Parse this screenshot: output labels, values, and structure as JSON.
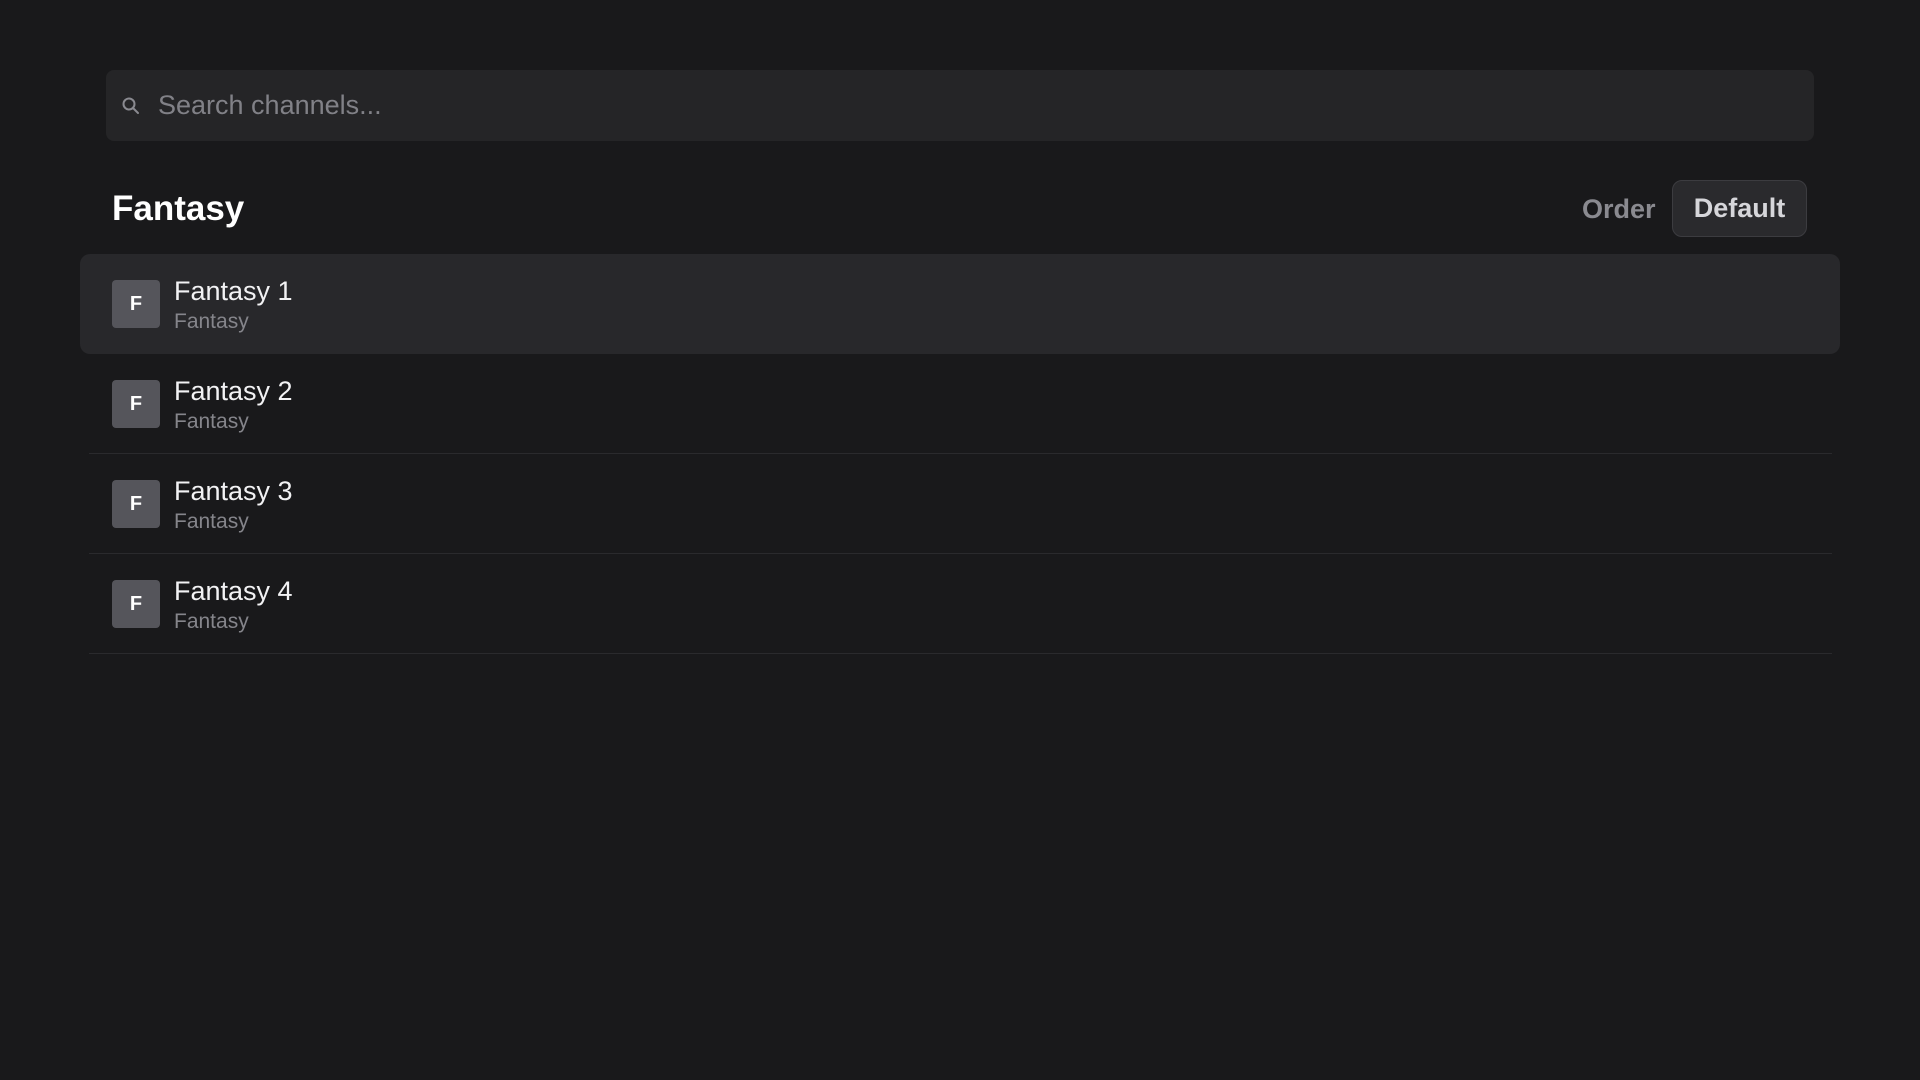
{
  "search": {
    "placeholder": "Search channels...",
    "value": ""
  },
  "section": {
    "title": "Fantasy",
    "order_label": "Order",
    "order_value": "Default"
  },
  "channels": [
    {
      "initial": "F",
      "name": "Fantasy 1",
      "category": "Fantasy",
      "selected": true
    },
    {
      "initial": "F",
      "name": "Fantasy 2",
      "category": "Fantasy",
      "selected": false
    },
    {
      "initial": "F",
      "name": "Fantasy 3",
      "category": "Fantasy",
      "selected": false
    },
    {
      "initial": "F",
      "name": "Fantasy 4",
      "category": "Fantasy",
      "selected": false
    }
  ],
  "colors": {
    "background": "#19191b",
    "search_bg": "#252527",
    "selected_row_bg": "#28282b",
    "avatar_bg": "#55555b"
  },
  "icons": {
    "search": "search-icon"
  }
}
